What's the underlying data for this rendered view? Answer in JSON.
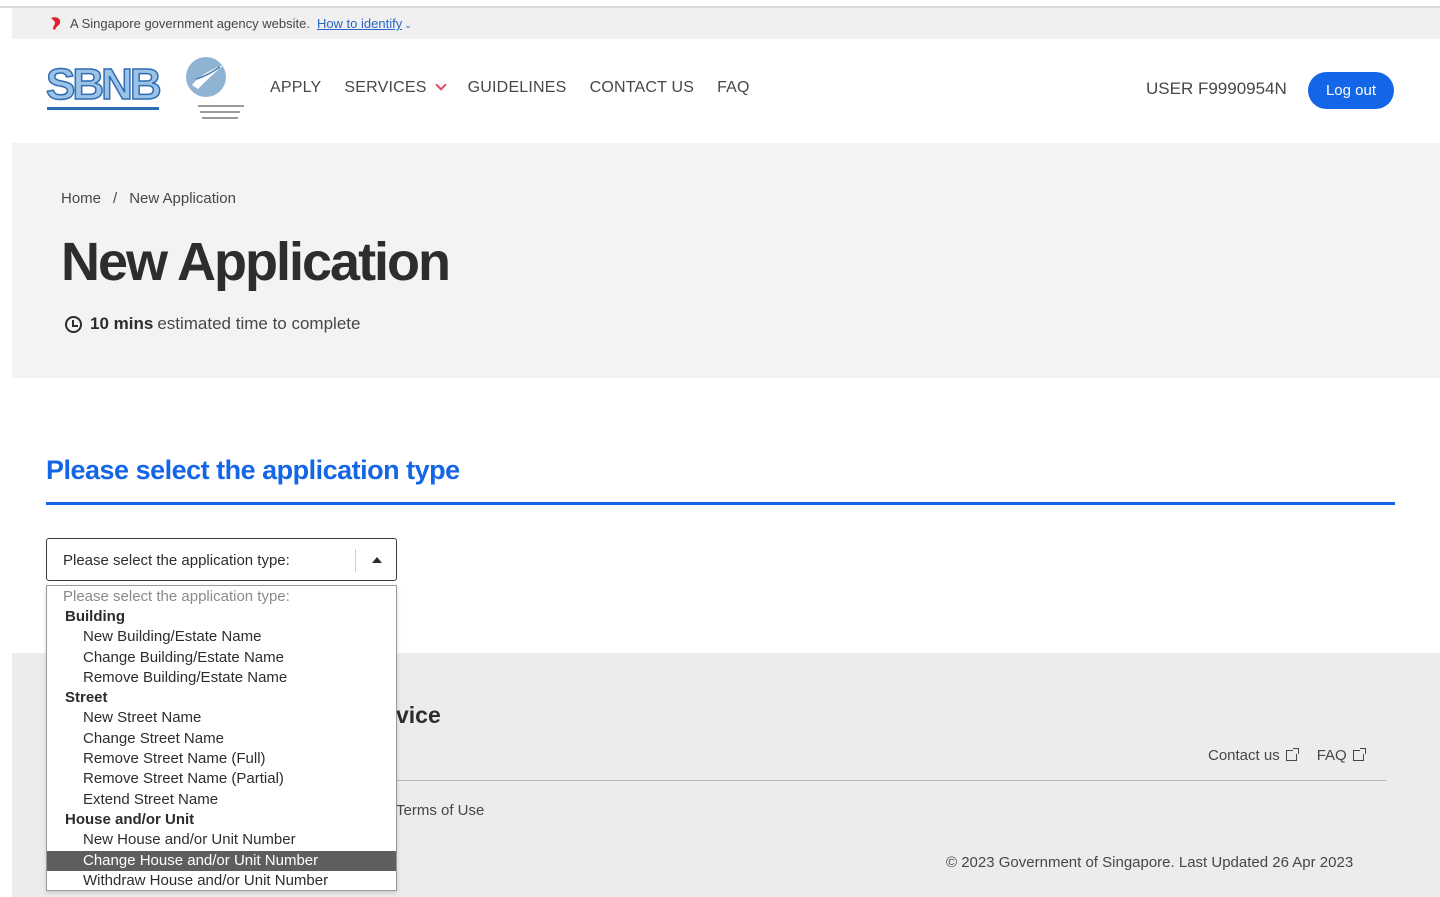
{
  "masthead": {
    "text": "A Singapore government agency website.",
    "identify_link": "How to identify"
  },
  "nav": {
    "logo_sbnb": "SBNB",
    "items": [
      "APPLY",
      "SERVICES",
      "GUIDELINES",
      "CONTACT US",
      "FAQ"
    ],
    "user": "USER F9990954N",
    "logout_label": "Log out"
  },
  "breadcrumb": {
    "home": "Home",
    "separator": "/",
    "current": "New Application"
  },
  "page": {
    "title": "New Application",
    "est_bold": "10 mins",
    "est_rest": "estimated time to complete"
  },
  "form": {
    "section_title": "Please select the application type",
    "select_value": "Please select the application type:",
    "dropdown": {
      "placeholder": "Please select the application type:",
      "groups": [
        {
          "label": "Building",
          "options": [
            "New Building/Estate Name",
            "Change Building/Estate Name",
            "Remove Building/Estate Name"
          ]
        },
        {
          "label": "Street",
          "options": [
            "New Street Name",
            "Change Street Name",
            "Remove Street Name (Full)",
            "Remove Street Name (Partial)",
            "Extend Street Name"
          ]
        },
        {
          "label": "House and/or Unit",
          "options": [
            "New House and/or Unit Number",
            "Change House and/or Unit Number",
            "Withdraw House and/or Unit Number"
          ]
        }
      ],
      "highlighted": "Change House and/or Unit Number"
    }
  },
  "footer": {
    "title_fragment": "vice",
    "contact": "Contact us",
    "faq": "FAQ",
    "terms_fragment": "Terms of Use",
    "copyright": "© 2023 Government of Singapore. Last Updated 26 Apr 2023"
  },
  "colors": {
    "primary_blue": "#1466e8",
    "lion_red": "#e0202c",
    "highlight_gray": "#5e5e5e"
  }
}
